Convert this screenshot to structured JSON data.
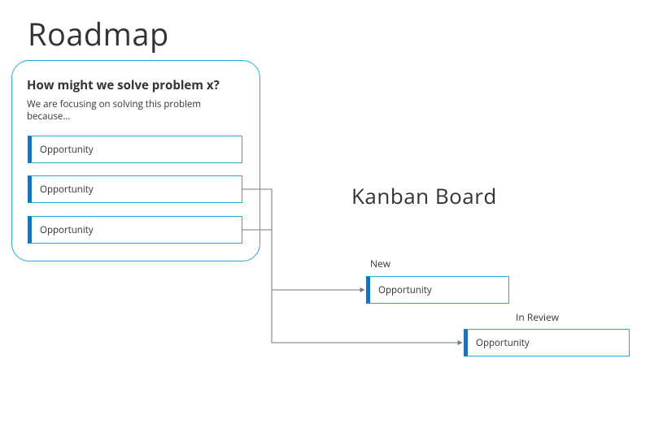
{
  "roadmap": {
    "title": "Roadmap",
    "question": "How might we solve problem x?",
    "subtitle": "We are focusing on solving this problem because…",
    "cards": [
      "Opportunity",
      "Opportunity",
      "Opportunity"
    ]
  },
  "kanban": {
    "title": "Kanban Board",
    "columns": {
      "new": {
        "label": "New",
        "card": "Opportunity"
      },
      "in_review": {
        "label": "In Review",
        "card": "Opportunity"
      }
    }
  },
  "colors": {
    "card_border": "#2aa7d6",
    "card_accent": "#1a73b8",
    "connector": "#777777"
  }
}
